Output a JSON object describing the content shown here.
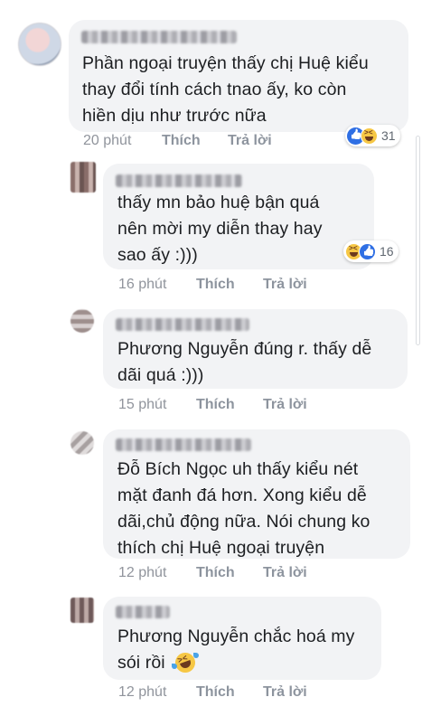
{
  "actions": {
    "like": "Thích",
    "reply": "Trả lời"
  },
  "comments": [
    {
      "text": "Phần ngoại truyện thấy chị Huệ kiểu\nthay đổi tính cách tnao ấy, ko còn\nhiền dịu như trước nữa",
      "time": "20 phút",
      "reaction_count": "31",
      "reactions": [
        "like-icon",
        "haha-icon"
      ]
    },
    {
      "text": "thấy mn bảo huệ bận quá\nnên mời my diễn thay hay\nsao ấy :)))",
      "time": "16 phút",
      "reaction_count": "16",
      "reactions": [
        "haha-icon",
        "like-icon"
      ]
    },
    {
      "text": "Phương Nguyễn  đúng r. thấy dễ\ndãi quá :)))",
      "time": "15 phút"
    },
    {
      "text": "Đỗ Bích Ngọc uh thấy kiểu nét\nmặt đanh đá hơn. Xong kiểu dễ\ndãi,chủ động nữa. Nói chung ko\nthích chị Huệ ngoại truyện",
      "time": "12 phút"
    },
    {
      "text": "Phương Nguyễn  chắc hoá my\nsói rồi",
      "time": "12 phút",
      "inline_emoji": "rolling-laughing-icon"
    }
  ],
  "colors": {
    "bubble": "#f2f3f5",
    "meta": "#90949c",
    "like": "#2f6fe4",
    "haha": "#f6c745"
  }
}
